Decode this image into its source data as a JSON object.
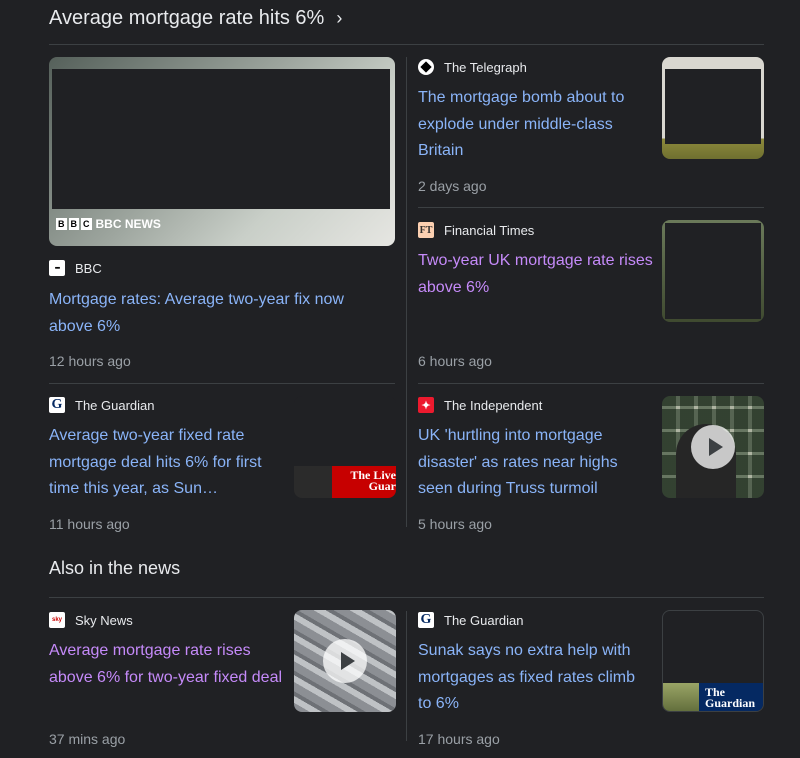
{
  "header": {
    "title": "Average mortgage rate hits 6%",
    "chevron": "›"
  },
  "stories": [
    {
      "source": "The Telegraph",
      "title": "The mortgage bomb about to explode under middle-class Britain",
      "time": "2 days ago"
    },
    {
      "source": "Financial Times",
      "favicon": "FT",
      "title": "Two-year UK mortgage rate rises above 6%",
      "time": "6 hours ago"
    },
    {
      "source": "BBC",
      "title": "Mortgage rates: Average two-year fix now above 6%",
      "time": "12 hours ago",
      "thumb_logo": "BBC NEWS"
    },
    {
      "source": "The Guardian",
      "favicon": "G",
      "title": "Average two-year fixed rate mortgage deal hits 6% for first time this year, as Sun…",
      "time": "11 hours ago",
      "thumb_logo": "The Live Guar"
    },
    {
      "source": "The Independent",
      "title": "UK 'hurtling into mortgage disaster' as rates near highs seen during Truss turmoil",
      "time": "5 hours ago"
    }
  ],
  "also_heading": "Also in the news",
  "also": [
    {
      "source": "Sky News",
      "favicon": "sky",
      "title": "Average mortgage rate rises above 6% for two-year fixed deal",
      "time": "37 mins ago"
    },
    {
      "source": "The Guardian",
      "favicon": "G",
      "title": "Sunak says no extra help with mortgages as fixed rates climb to 6%",
      "time": "17 hours ago",
      "thumb_logo": "The Guardian"
    }
  ],
  "colors": {
    "background": "#202124",
    "link": "#8ab4f8",
    "visited_link": "#c58af9",
    "meta": "#9aa0a6"
  }
}
